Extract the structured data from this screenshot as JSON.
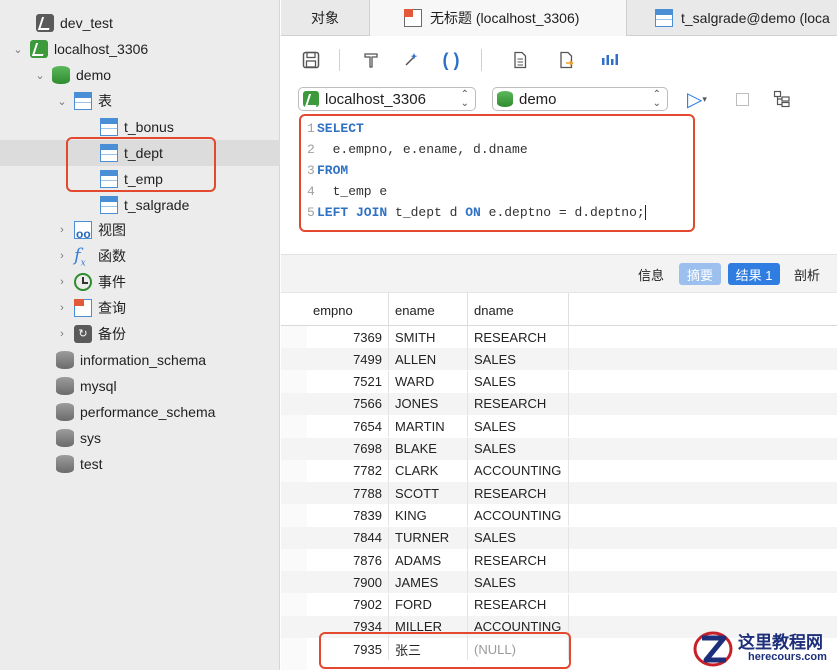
{
  "sidebar": {
    "items": [
      {
        "label": "dev_test"
      },
      {
        "label": "localhost_3306"
      },
      {
        "label": "demo"
      },
      {
        "label": "表"
      },
      {
        "label": "t_bonus"
      },
      {
        "label": "t_dept"
      },
      {
        "label": "t_emp"
      },
      {
        "label": "t_salgrade"
      },
      {
        "label": "视图"
      },
      {
        "label": "函数"
      },
      {
        "label": "事件"
      },
      {
        "label": "查询"
      },
      {
        "label": "备份"
      },
      {
        "label": "information_schema"
      },
      {
        "label": "mysql"
      },
      {
        "label": "performance_schema"
      },
      {
        "label": "sys"
      },
      {
        "label": "test"
      }
    ]
  },
  "tabs": [
    {
      "label": "对象"
    },
    {
      "label": "无标题 (localhost_3306)"
    },
    {
      "label": "t_salgrade@demo (loca"
    }
  ],
  "selectors": {
    "connection": "localhost_3306",
    "database": "demo"
  },
  "editor": {
    "line_numbers": [
      "1",
      "2",
      "3",
      "4",
      "5"
    ],
    "l1_kw": "SELECT",
    "l2_text": "  e.empno, e.ename, d.dname",
    "l3_kw": "FROM",
    "l4_text": "  t_emp e",
    "l5_kw1": "LEFT JOIN",
    "l5_t1": " t_dept d ",
    "l5_kw2": "ON",
    "l5_t2": " e.deptno = d.deptno;"
  },
  "result_tabs": {
    "info": "信息",
    "summary": "摘要",
    "result1": "结果 1",
    "profile": "剖析"
  },
  "grid": {
    "columns": [
      "empno",
      "ename",
      "dname"
    ],
    "rows": [
      [
        "7369",
        "SMITH",
        "RESEARCH"
      ],
      [
        "7499",
        "ALLEN",
        "SALES"
      ],
      [
        "7521",
        "WARD",
        "SALES"
      ],
      [
        "7566",
        "JONES",
        "RESEARCH"
      ],
      [
        "7654",
        "MARTIN",
        "SALES"
      ],
      [
        "7698",
        "BLAKE",
        "SALES"
      ],
      [
        "7782",
        "CLARK",
        "ACCOUNTING"
      ],
      [
        "7788",
        "SCOTT",
        "RESEARCH"
      ],
      [
        "7839",
        "KING",
        "ACCOUNTING"
      ],
      [
        "7844",
        "TURNER",
        "SALES"
      ],
      [
        "7876",
        "ADAMS",
        "RESEARCH"
      ],
      [
        "7900",
        "JAMES",
        "SALES"
      ],
      [
        "7902",
        "FORD",
        "RESEARCH"
      ],
      [
        "7934",
        "MILLER",
        "ACCOUNTING"
      ],
      [
        "7935",
        "张三",
        "(NULL)"
      ]
    ]
  },
  "watermark": {
    "cn": "这里教程网",
    "en": "herecours.com"
  },
  "colors": {
    "highlight": "#e2492f",
    "accent": "#2f7de1",
    "keyword": "#2f72c4"
  }
}
